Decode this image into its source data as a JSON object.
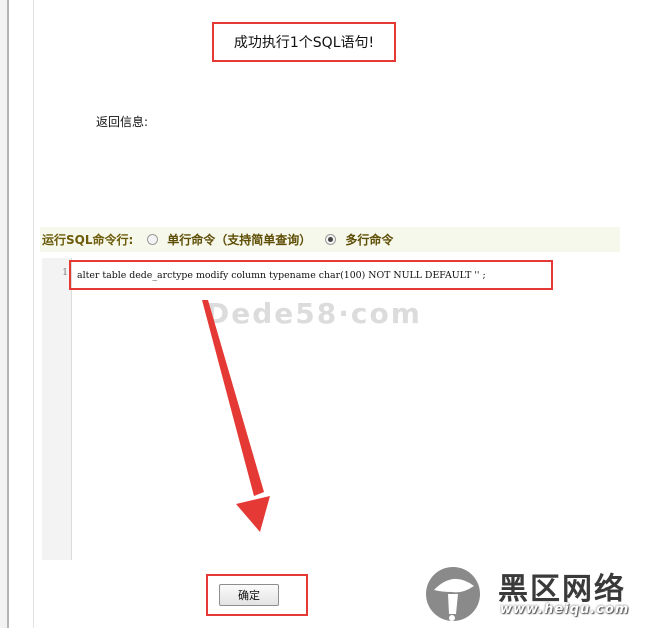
{
  "result": {
    "message": "成功执行1个SQL语句!"
  },
  "return_info": {
    "label": "返回信息:"
  },
  "command_mode": {
    "label": "运行SQL命令行:",
    "options": [
      {
        "label": "单行命令（支持简单查询）",
        "selected": false
      },
      {
        "label": "多行命令",
        "selected": true
      }
    ]
  },
  "editor": {
    "line_number": "1",
    "sql": "alter table dede_arctype modify column typename char(100) NOT NULL DEFAULT '' ;"
  },
  "submit": {
    "label": "确定"
  },
  "watermarks": {
    "dede": "Dede58·com",
    "heiqu_title": "黑区网络",
    "heiqu_url": "www.heiqu.com"
  },
  "colors": {
    "highlight": "#e53935",
    "command_bar": "#f7f8ec",
    "arrow": "#e53935"
  }
}
